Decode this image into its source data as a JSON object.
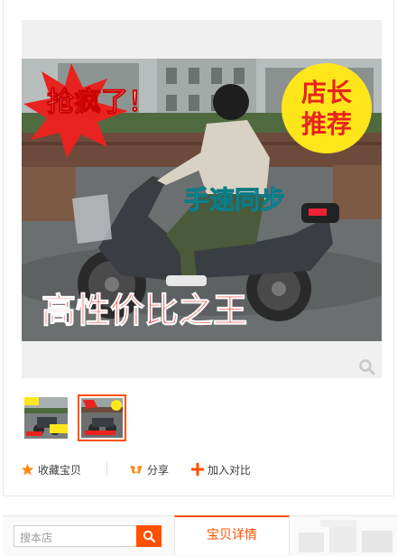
{
  "gallery": {
    "main_image": {
      "badge_top_left": "抢疯了！",
      "badge_top_right_line1": "店长",
      "badge_top_right_line2": "推荐",
      "caption_middle": "手速同步",
      "caption_bottom": "高性价比之王"
    },
    "thumbnails": [
      {
        "selected": false
      },
      {
        "selected": true
      }
    ]
  },
  "actions": {
    "favorite_label": "收藏宝贝",
    "share_label": "分享",
    "compare_label": "加入对比"
  },
  "shop_search": {
    "placeholder": "搜本店"
  },
  "tabs": {
    "detail_label": "宝贝详情"
  },
  "colors": {
    "accent": "#ff5000",
    "star": "#ff8c1a",
    "badge_red": "#e8231f",
    "badge_yellow": "#ffe61a",
    "caption_cyan": "#35d8e8"
  }
}
